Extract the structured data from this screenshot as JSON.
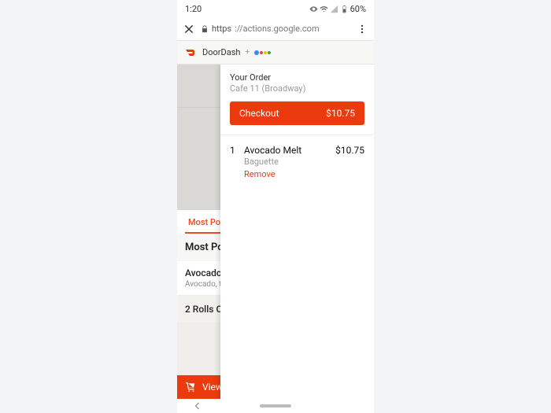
{
  "status": {
    "time": "1:20",
    "battery": "60%"
  },
  "url": {
    "scheme": "https",
    "rest": "://actions.google.com"
  },
  "brand": {
    "name": "DoorDash",
    "plus": "+"
  },
  "bg": {
    "tab": "Most Popu",
    "section": "Most Po",
    "item1_title": "Avocado",
    "item1_desc": "Avocado,                     tomato, or",
    "item2_title": "2 Rolls C",
    "view": "View"
  },
  "cart": {
    "label": "Your Order",
    "restaurant": "Cafe 11 (Broadway)",
    "checkout_label": "Checkout",
    "total": "$10.75",
    "items": [
      {
        "qty": "1",
        "name": "Avocado Melt",
        "option": "Baguette",
        "remove": "Remove",
        "price": "$10.75"
      }
    ]
  }
}
